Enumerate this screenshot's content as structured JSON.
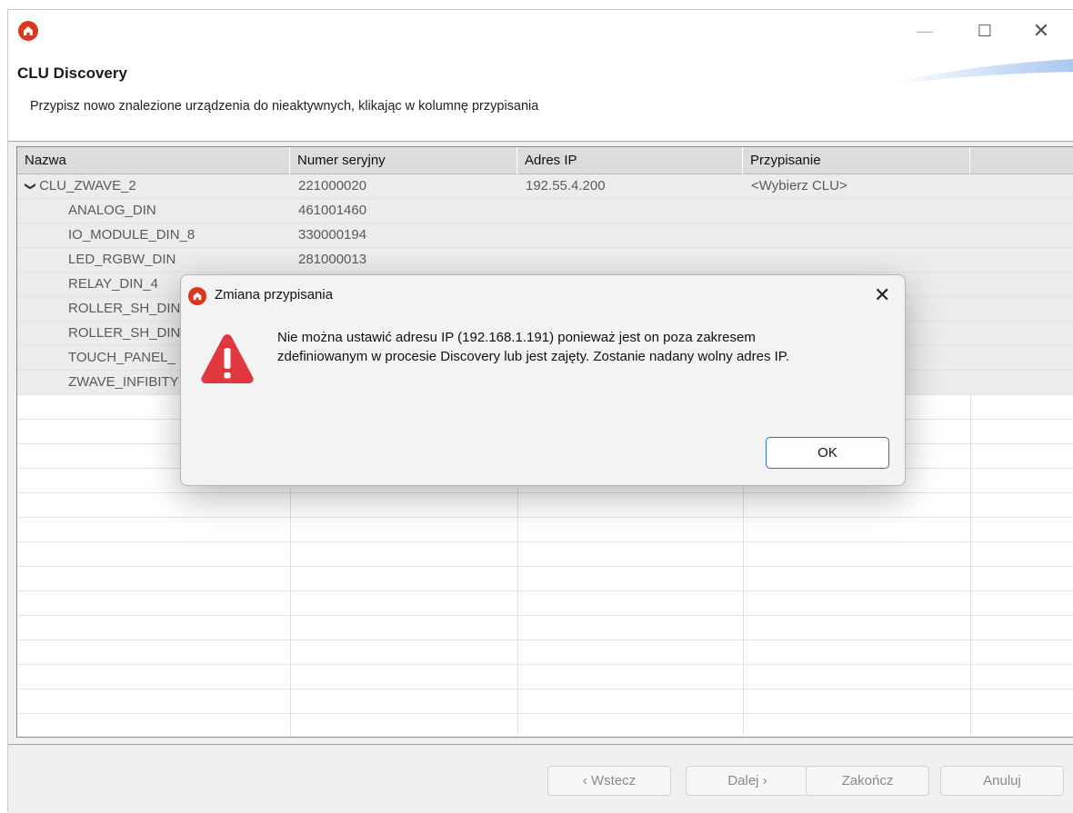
{
  "window": {
    "minimize_icon": "—",
    "maximize_icon": "☐",
    "close_icon": "✕"
  },
  "header": {
    "title": "CLU Discovery",
    "subtitle": "Przypisz nowo znalezione urządzenia do nieaktywnych, klikając w kolumnę przypisania"
  },
  "table": {
    "columns": [
      "Nazwa",
      "Numer seryjny",
      "Adres IP",
      "Przypisanie"
    ],
    "rows": [
      {
        "name": "CLU_ZWAVE_2",
        "serial": "221000020",
        "ip": "192.55.4.200",
        "assign": "<Wybierz CLU>",
        "expanded": true
      },
      {
        "name": "ANALOG_DIN",
        "serial": "461001460",
        "ip": "",
        "assign": ""
      },
      {
        "name": "IO_MODULE_DIN_8",
        "serial": "330000194",
        "ip": "",
        "assign": ""
      },
      {
        "name": "LED_RGBW_DIN",
        "serial": "281000013",
        "ip": "",
        "assign": ""
      },
      {
        "name": "RELAY_DIN_4",
        "serial": "",
        "ip": "",
        "assign": ""
      },
      {
        "name": "ROLLER_SH_DIN",
        "serial": "",
        "ip": "",
        "assign": ""
      },
      {
        "name": "ROLLER_SH_DIN",
        "serial": "",
        "ip": "",
        "assign": ""
      },
      {
        "name": "TOUCH_PANEL_",
        "serial": "",
        "ip": "",
        "assign": ""
      },
      {
        "name": "ZWAVE_INFIBITY",
        "serial": "",
        "ip": "",
        "assign": ""
      }
    ]
  },
  "footer": {
    "back": "‹ Wstecz",
    "next": "Dalej ›",
    "finish": "Zakończ",
    "cancel": "Anuluj"
  },
  "dialog": {
    "title": "Zmiana przypisania",
    "close_icon": "✕",
    "icon": "warning-icon",
    "message_line1": "Nie można ustawić adresu IP (192.168.1.191) ponieważ jest on poza zakresem",
    "message_line2": "zdefiniowanym w procesie Discovery lub jest zajęty. Zostanie nadany wolny adres IP.",
    "ok": "OK"
  },
  "colors": {
    "brand_red": "#d9381e",
    "warning_red": "#e0383e",
    "accent_blue": "#2d6fc4"
  }
}
